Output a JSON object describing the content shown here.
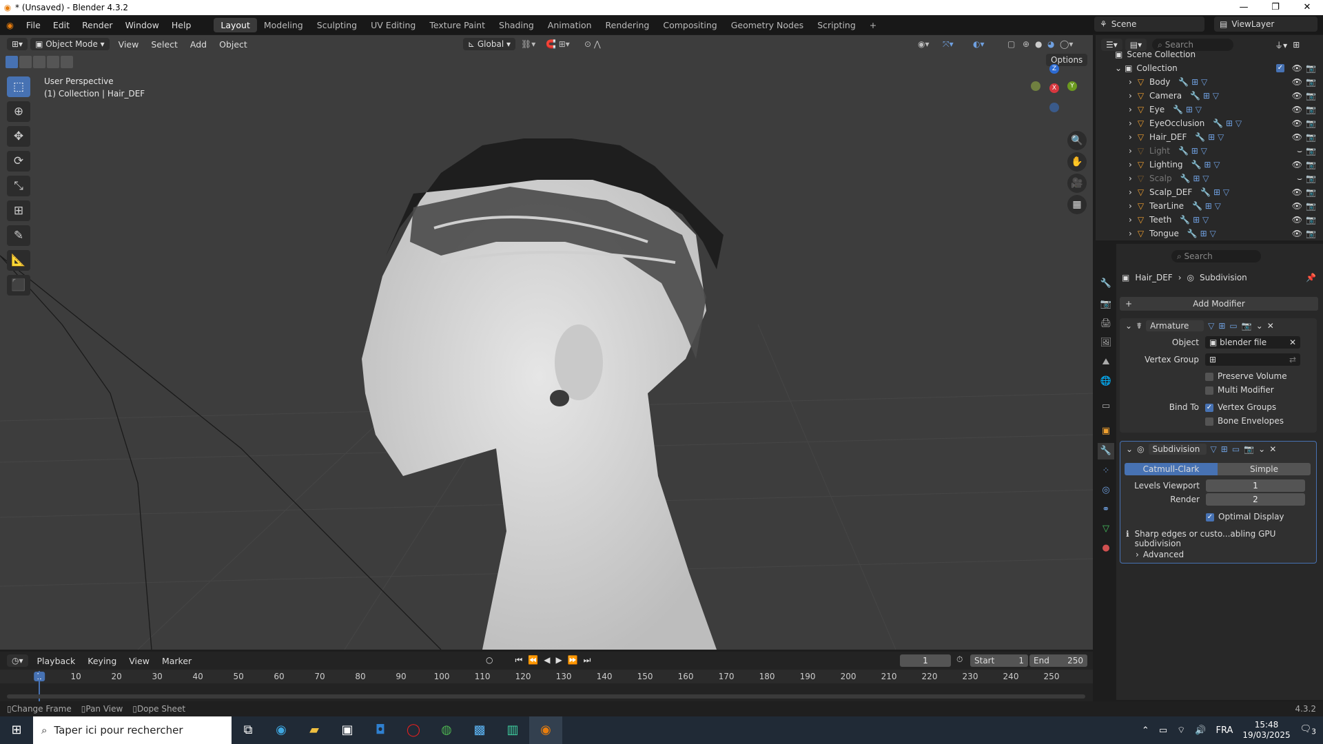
{
  "window": {
    "title": "* (Unsaved) - Blender 4.3.2",
    "min": "—",
    "max": "❐",
    "close": "✕"
  },
  "menu": {
    "items": [
      "File",
      "Edit",
      "Render",
      "Window",
      "Help"
    ],
    "workspaces": [
      "Layout",
      "Modeling",
      "Sculpting",
      "UV Editing",
      "Texture Paint",
      "Shading",
      "Animation",
      "Rendering",
      "Compositing",
      "Geometry Nodes",
      "Scripting"
    ],
    "active_workspace": "Layout",
    "add_tab": "+",
    "scene": "Scene",
    "viewlayer": "ViewLayer"
  },
  "viewport": {
    "mode": "Object Mode",
    "menus": [
      "View",
      "Select",
      "Add",
      "Object"
    ],
    "orientation": "Global",
    "options": "Options",
    "info_line1": "User Perspective",
    "info_line2": "(1) Collection | Hair_DEF",
    "axes": {
      "z": "Z",
      "y": "Y",
      "x": "X"
    }
  },
  "outliner": {
    "search_placeholder": "Search",
    "scene_collection": "Scene Collection",
    "collection": "Collection",
    "items": [
      {
        "name": "Body",
        "dim": false
      },
      {
        "name": "Camera",
        "dim": false
      },
      {
        "name": "Eye",
        "dim": false
      },
      {
        "name": "EyeOcclusion",
        "dim": false
      },
      {
        "name": "Hair_DEF",
        "dim": false
      },
      {
        "name": "Light",
        "dim": true
      },
      {
        "name": "Lighting",
        "dim": false
      },
      {
        "name": "Scalp",
        "dim": true
      },
      {
        "name": "Scalp_DEF",
        "dim": false
      },
      {
        "name": "TearLine",
        "dim": false
      },
      {
        "name": "Teeth",
        "dim": false
      },
      {
        "name": "Tongue",
        "dim": false
      }
    ]
  },
  "properties": {
    "search_placeholder": "Search",
    "breadcrumb_object": "Hair_DEF",
    "breadcrumb_modifier": "Subdivision",
    "add_modifier": "Add Modifier",
    "armature": {
      "name": "Armature",
      "object_label": "Object",
      "object_value": "blender file",
      "vertex_group_label": "Vertex Group",
      "preserve_volume": "Preserve Volume",
      "multi_modifier": "Multi Modifier",
      "bind_to_label": "Bind To",
      "vertex_groups": "Vertex Groups",
      "bone_envelopes": "Bone Envelopes"
    },
    "subdivision": {
      "name": "Subdivision",
      "mode_a": "Catmull-Clark",
      "mode_b": "Simple",
      "levels_viewport_label": "Levels Viewport",
      "levels_viewport": "1",
      "render_label": "Render",
      "render_value": "2",
      "optimal_display": "Optimal Display",
      "info": "Sharp edges or custo...abling GPU subdivision",
      "advanced": "Advanced"
    }
  },
  "timeline": {
    "menus": [
      "Playback",
      "Keying",
      "View",
      "Marker"
    ],
    "current_frame": "1",
    "start_label": "Start",
    "start": "1",
    "end_label": "End",
    "end": "250",
    "ticks": [
      "1",
      "10",
      "20",
      "30",
      "40",
      "50",
      "60",
      "70",
      "80",
      "90",
      "100",
      "110",
      "120",
      "130",
      "140",
      "150",
      "160",
      "170",
      "180",
      "190",
      "200",
      "210",
      "220",
      "230",
      "240",
      "250"
    ]
  },
  "status": {
    "change_frame": "Change Frame",
    "pan_view": "Pan View",
    "dope_sheet": "Dope Sheet",
    "version": "4.3.2"
  },
  "taskbar": {
    "search": "Taper ici pour rechercher",
    "lang": "FRA",
    "time": "15:48",
    "date": "19/03/2025",
    "notif": "3"
  }
}
